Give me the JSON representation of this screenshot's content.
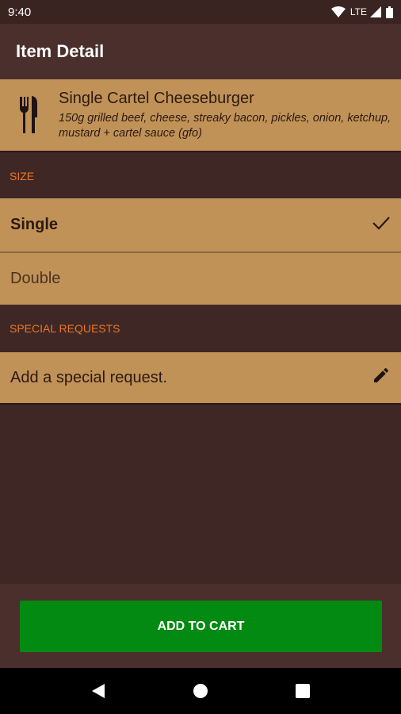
{
  "status_bar": {
    "time": "9:40",
    "network": "LTE"
  },
  "app_bar": {
    "title": "Item Detail"
  },
  "item": {
    "icon": "fork-knife-icon",
    "name": "Single Cartel Cheeseburger",
    "description": "150g grilled beef, cheese, streaky bacon, pickles, onion, ketchup, mustard + cartel sauce (gfo)"
  },
  "size_section": {
    "header": "SIZE",
    "options": [
      {
        "label": "Single",
        "selected": true
      },
      {
        "label": "Double",
        "selected": false
      }
    ]
  },
  "special_requests": {
    "header": "SPECIAL REQUESTS",
    "placeholder": "Add a special request.",
    "icon": "pencil-icon"
  },
  "cart": {
    "button_label": "ADD TO CART"
  },
  "nav": {
    "back": "back-icon",
    "home": "home-icon",
    "recents": "recents-icon"
  },
  "colors": {
    "accent": "#ec7424",
    "card": "#c19258",
    "button": "#038a12",
    "background": "#3f2725"
  }
}
